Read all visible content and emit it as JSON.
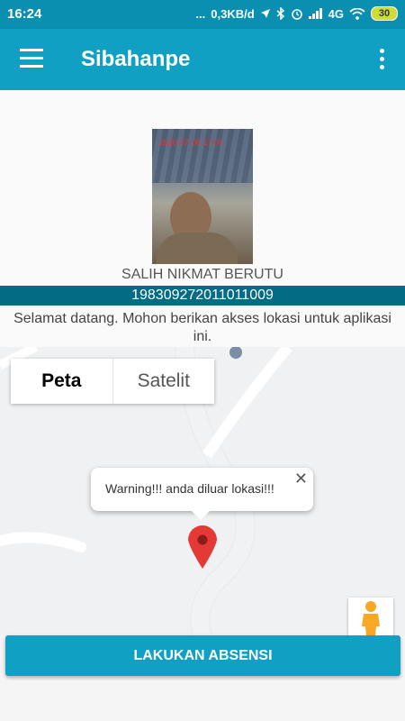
{
  "status_bar": {
    "time": "16:24",
    "dots": "...",
    "network_speed": "0,3KB/d",
    "network_type": "4G",
    "battery": "30"
  },
  "app_bar": {
    "title": "Sibahanpe",
    "menu_icon": "hamburger-menu-icon",
    "overflow_icon": "more-vert-icon"
  },
  "profile": {
    "photo_timestamp": "2020-07-08 17:00",
    "name": "SALIH NIKMAT BERUTU",
    "nip": "198309272011011009"
  },
  "message": "Selamat datang. Mohon berikan akses lokasi untuk aplikasi ini.",
  "map": {
    "toggle": [
      "Peta",
      "Satelit"
    ],
    "selected": "Peta",
    "infowindow_text": "Warning!!! anda diluar lokasi!!!",
    "close_symbol": "✕"
  },
  "action_button": "LAKUKAN ABSENSI",
  "colors": {
    "primary": "#0fa0c4",
    "status_bar": "#0a8fb0",
    "nip_bar": "#046b85",
    "marker": "#e53935"
  }
}
